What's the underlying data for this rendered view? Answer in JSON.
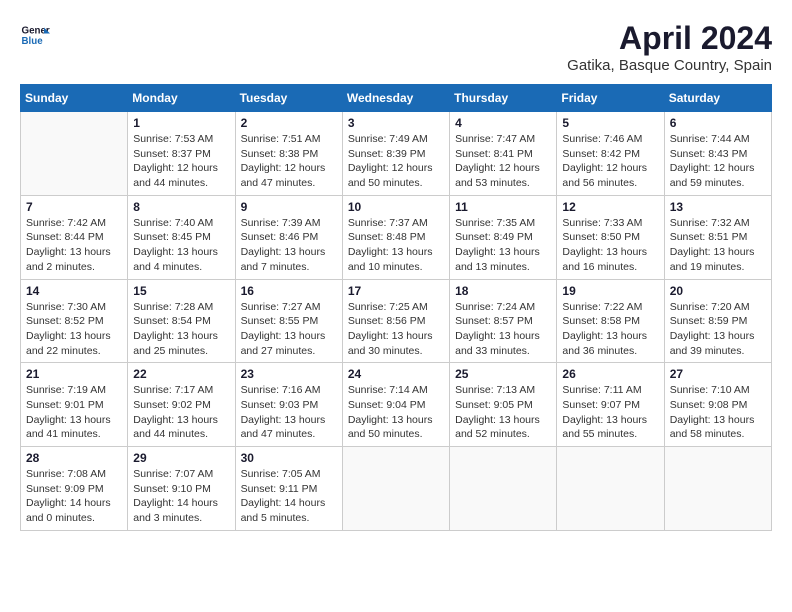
{
  "header": {
    "logo_line1": "General",
    "logo_line2": "Blue",
    "title": "April 2024",
    "subtitle": "Gatika, Basque Country, Spain"
  },
  "days_of_week": [
    "Sunday",
    "Monday",
    "Tuesday",
    "Wednesday",
    "Thursday",
    "Friday",
    "Saturday"
  ],
  "weeks": [
    [
      {
        "day": "",
        "info": ""
      },
      {
        "day": "1",
        "info": "Sunrise: 7:53 AM\nSunset: 8:37 PM\nDaylight: 12 hours\nand 44 minutes."
      },
      {
        "day": "2",
        "info": "Sunrise: 7:51 AM\nSunset: 8:38 PM\nDaylight: 12 hours\nand 47 minutes."
      },
      {
        "day": "3",
        "info": "Sunrise: 7:49 AM\nSunset: 8:39 PM\nDaylight: 12 hours\nand 50 minutes."
      },
      {
        "day": "4",
        "info": "Sunrise: 7:47 AM\nSunset: 8:41 PM\nDaylight: 12 hours\nand 53 minutes."
      },
      {
        "day": "5",
        "info": "Sunrise: 7:46 AM\nSunset: 8:42 PM\nDaylight: 12 hours\nand 56 minutes."
      },
      {
        "day": "6",
        "info": "Sunrise: 7:44 AM\nSunset: 8:43 PM\nDaylight: 12 hours\nand 59 minutes."
      }
    ],
    [
      {
        "day": "7",
        "info": "Sunrise: 7:42 AM\nSunset: 8:44 PM\nDaylight: 13 hours\nand 2 minutes."
      },
      {
        "day": "8",
        "info": "Sunrise: 7:40 AM\nSunset: 8:45 PM\nDaylight: 13 hours\nand 4 minutes."
      },
      {
        "day": "9",
        "info": "Sunrise: 7:39 AM\nSunset: 8:46 PM\nDaylight: 13 hours\nand 7 minutes."
      },
      {
        "day": "10",
        "info": "Sunrise: 7:37 AM\nSunset: 8:48 PM\nDaylight: 13 hours\nand 10 minutes."
      },
      {
        "day": "11",
        "info": "Sunrise: 7:35 AM\nSunset: 8:49 PM\nDaylight: 13 hours\nand 13 minutes."
      },
      {
        "day": "12",
        "info": "Sunrise: 7:33 AM\nSunset: 8:50 PM\nDaylight: 13 hours\nand 16 minutes."
      },
      {
        "day": "13",
        "info": "Sunrise: 7:32 AM\nSunset: 8:51 PM\nDaylight: 13 hours\nand 19 minutes."
      }
    ],
    [
      {
        "day": "14",
        "info": "Sunrise: 7:30 AM\nSunset: 8:52 PM\nDaylight: 13 hours\nand 22 minutes."
      },
      {
        "day": "15",
        "info": "Sunrise: 7:28 AM\nSunset: 8:54 PM\nDaylight: 13 hours\nand 25 minutes."
      },
      {
        "day": "16",
        "info": "Sunrise: 7:27 AM\nSunset: 8:55 PM\nDaylight: 13 hours\nand 27 minutes."
      },
      {
        "day": "17",
        "info": "Sunrise: 7:25 AM\nSunset: 8:56 PM\nDaylight: 13 hours\nand 30 minutes."
      },
      {
        "day": "18",
        "info": "Sunrise: 7:24 AM\nSunset: 8:57 PM\nDaylight: 13 hours\nand 33 minutes."
      },
      {
        "day": "19",
        "info": "Sunrise: 7:22 AM\nSunset: 8:58 PM\nDaylight: 13 hours\nand 36 minutes."
      },
      {
        "day": "20",
        "info": "Sunrise: 7:20 AM\nSunset: 8:59 PM\nDaylight: 13 hours\nand 39 minutes."
      }
    ],
    [
      {
        "day": "21",
        "info": "Sunrise: 7:19 AM\nSunset: 9:01 PM\nDaylight: 13 hours\nand 41 minutes."
      },
      {
        "day": "22",
        "info": "Sunrise: 7:17 AM\nSunset: 9:02 PM\nDaylight: 13 hours\nand 44 minutes."
      },
      {
        "day": "23",
        "info": "Sunrise: 7:16 AM\nSunset: 9:03 PM\nDaylight: 13 hours\nand 47 minutes."
      },
      {
        "day": "24",
        "info": "Sunrise: 7:14 AM\nSunset: 9:04 PM\nDaylight: 13 hours\nand 50 minutes."
      },
      {
        "day": "25",
        "info": "Sunrise: 7:13 AM\nSunset: 9:05 PM\nDaylight: 13 hours\nand 52 minutes."
      },
      {
        "day": "26",
        "info": "Sunrise: 7:11 AM\nSunset: 9:07 PM\nDaylight: 13 hours\nand 55 minutes."
      },
      {
        "day": "27",
        "info": "Sunrise: 7:10 AM\nSunset: 9:08 PM\nDaylight: 13 hours\nand 58 minutes."
      }
    ],
    [
      {
        "day": "28",
        "info": "Sunrise: 7:08 AM\nSunset: 9:09 PM\nDaylight: 14 hours\nand 0 minutes."
      },
      {
        "day": "29",
        "info": "Sunrise: 7:07 AM\nSunset: 9:10 PM\nDaylight: 14 hours\nand 3 minutes."
      },
      {
        "day": "30",
        "info": "Sunrise: 7:05 AM\nSunset: 9:11 PM\nDaylight: 14 hours\nand 5 minutes."
      },
      {
        "day": "",
        "info": ""
      },
      {
        "day": "",
        "info": ""
      },
      {
        "day": "",
        "info": ""
      },
      {
        "day": "",
        "info": ""
      }
    ]
  ]
}
